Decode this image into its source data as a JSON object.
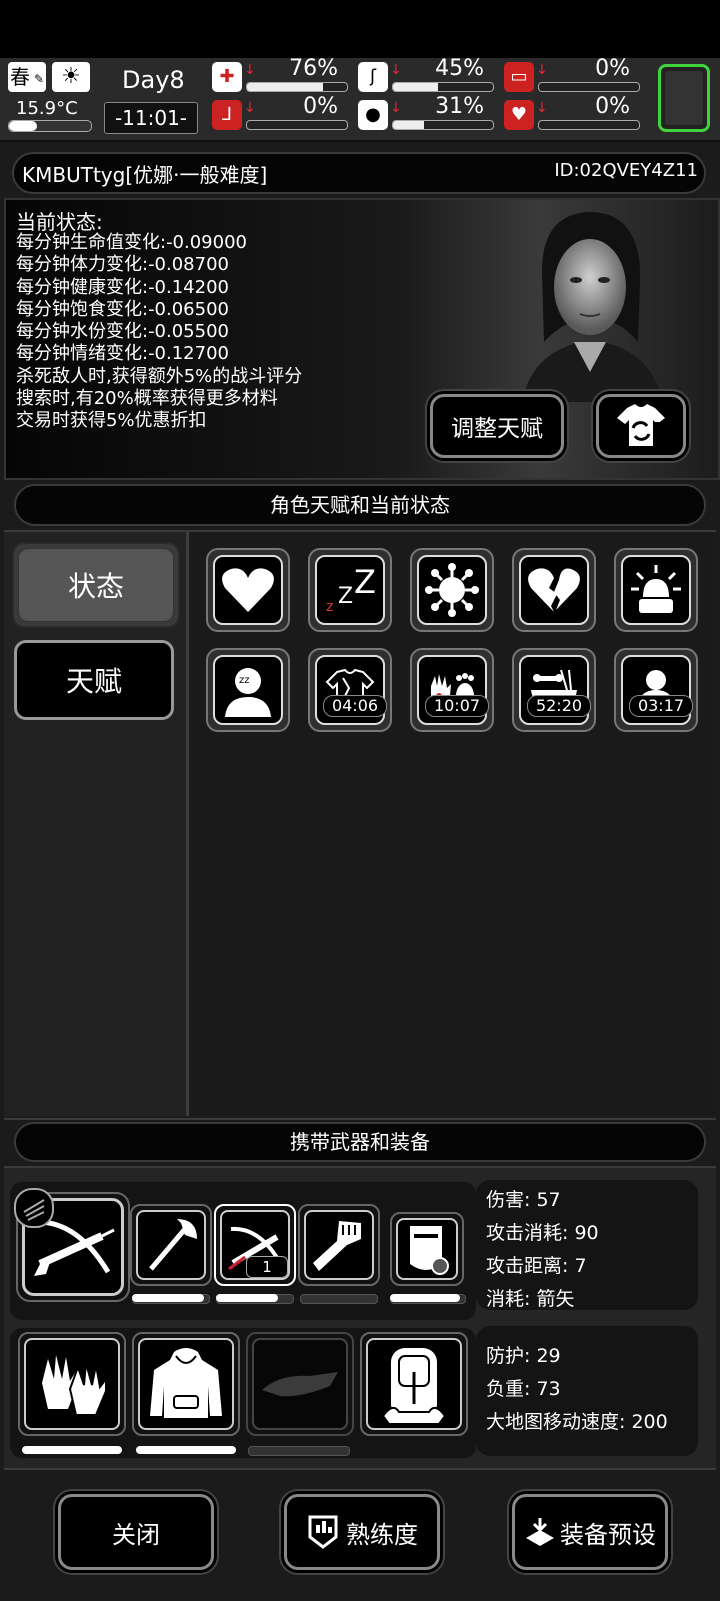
{
  "hud": {
    "season": "春",
    "temperature": "15.9°C",
    "temperature_level": 0.5,
    "day": "Day8",
    "time": "-11:01-",
    "stats": [
      {
        "name": "health",
        "icon": "medkit-icon",
        "value": "76%",
        "level": 0.76
      },
      {
        "name": "hunger",
        "icon": "stomach-icon",
        "value": "45%",
        "level": 0.45
      },
      {
        "name": "infection",
        "icon": "capsule-icon",
        "value": "0%",
        "level": 0
      },
      {
        "name": "injury",
        "icon": "leg-icon",
        "value": "0%",
        "level": 0
      },
      {
        "name": "thirst",
        "icon": "water-drop-icon",
        "value": "31%",
        "level": 0.31
      },
      {
        "name": "heart",
        "icon": "heart-icon",
        "value": "0%",
        "level": 0
      }
    ]
  },
  "profile": {
    "name": "KMBUTtyg[优娜·一般难度]",
    "id": "ID:02QVEY4Z11"
  },
  "status": {
    "title": "当前状态:",
    "lines": [
      "每分钟生命值变化:-0.09000",
      "每分钟体力变化:-0.08700",
      "每分钟健康变化:-0.14200",
      "每分钟饱食变化:-0.06500",
      "每分钟水份变化:-0.05500",
      "每分钟情绪变化:-0.12700",
      "杀死敌人时,获得额外5%的战斗评分",
      "搜索时,有20%概率获得更多材料",
      "交易时获得5%优惠折扣"
    ],
    "adjust_label": "调整天赋"
  },
  "talent_section": {
    "header": "角色天赋和当前状态",
    "tabs": [
      {
        "label": "状态",
        "active": true
      },
      {
        "label": "天赋",
        "active": false
      }
    ],
    "tiles": [
      {
        "icon": "heart-icon",
        "timer": ""
      },
      {
        "icon": "sleep-zzz-icon",
        "timer": ""
      },
      {
        "icon": "virus-icon",
        "timer": ""
      },
      {
        "icon": "broken-heart-icon",
        "timer": ""
      },
      {
        "icon": "alarm-siren-icon",
        "timer": ""
      },
      {
        "icon": "sleepy-person-icon",
        "timer": ""
      },
      {
        "icon": "torn-clothes-icon",
        "timer": "04:06"
      },
      {
        "icon": "dirty-hands-feet-icon",
        "timer": "10:07"
      },
      {
        "icon": "food-bowl-icon",
        "timer": "52:20"
      },
      {
        "icon": "sick-person-icon",
        "timer": "03:17"
      }
    ]
  },
  "equip_section": {
    "header": "携带武器和装备",
    "weapons": [
      {
        "icon": "crossbow-icon",
        "durability": null
      },
      {
        "icon": "axe-icon",
        "durability": 0.95
      },
      {
        "icon": "crossbow-bolt-icon",
        "durability": 0.8,
        "count": "1"
      },
      {
        "icon": "fist-icon",
        "durability": 0
      },
      {
        "icon": "riot-shield-icon",
        "durability": 0.95
      }
    ],
    "weapon_stats": [
      "伤害: 57",
      "攻击消耗: 90",
      "攻击距离: 7",
      "消耗: 箭矢"
    ],
    "gear": [
      {
        "icon": "gloves-icon",
        "durability": 0.98
      },
      {
        "icon": "hoodie-icon",
        "durability": 0.98
      },
      {
        "icon": "cap-icon",
        "durability": 0
      },
      {
        "icon": "backpack-icon",
        "durability": null
      }
    ],
    "gear_stats": [
      "防护: 29",
      "负重: 73",
      "大地图移动速度: 200"
    ]
  },
  "footer": {
    "close_label": "关闭",
    "proficiency_label": "熟练度",
    "preset_label": "装备预设"
  }
}
